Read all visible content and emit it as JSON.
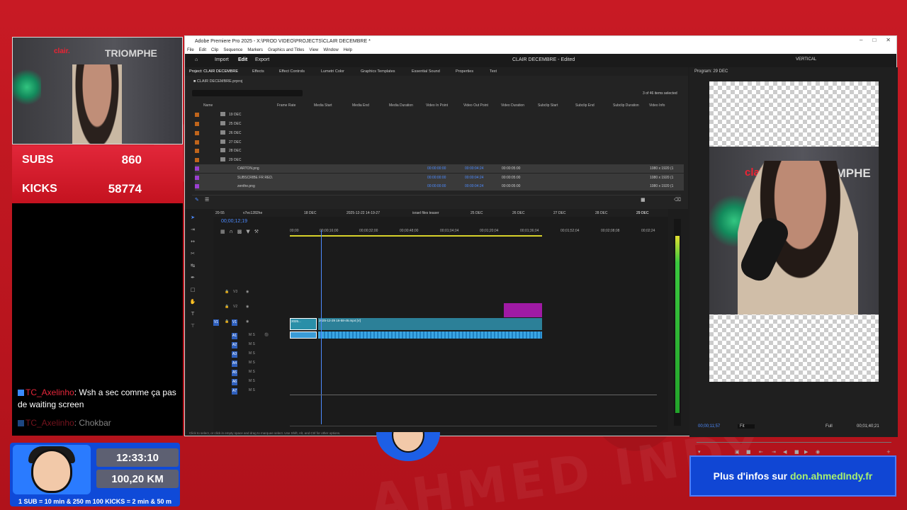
{
  "overlay": {
    "subs_label": "SUBS",
    "subs_value": "860",
    "kicks_label": "KICKS",
    "kicks_value": "58774",
    "cam_sign": "TRIOMPHE",
    "cam_clair": "clair.",
    "chat": [
      {
        "user": "TC_Axelinho",
        "message": "Wsh a sec comme ça pas de waiting screen"
      },
      {
        "user": "TC_Axelinho",
        "message": "Chokbar"
      }
    ],
    "widget": {
      "time": "12:33:10",
      "distance": "100,20 KM",
      "footer": "1 SUB = 10 min & 250 m     100 KICKS = 2 min & 50 m"
    },
    "info_text": "Plus d'infos sur",
    "info_link": "don.ahmedIndy.fr",
    "bg_text": "AHMED INDY"
  },
  "premiere": {
    "title": "Adobe Premiere Pro 2025 - X:\\PROD VIDEO\\PROJECTS\\CLAIR DECEMBRE *",
    "menu": [
      "File",
      "Edit",
      "Clip",
      "Sequence",
      "Markers",
      "Graphics and Titles",
      "View",
      "Window",
      "Help"
    ],
    "appbar": {
      "import": "Import",
      "edit": "Edit",
      "export": "Export",
      "center": "CLAIR DECEMBRE - Edited",
      "vertical": "VERTICAL"
    },
    "tabs": [
      "Project: CLAIR DECEMBRE",
      "Effects",
      "Effect Controls",
      "Lumetri Color",
      "Graphics Templates",
      "Essential Sound",
      "Properties",
      "Text"
    ],
    "project_file": "CLAIR DECEMBRE.prproj",
    "items_selected": "3 of 46 items selected",
    "columns": [
      "Name",
      "Frame Rate",
      "Media Start",
      "Media End",
      "Media Duration",
      "Video In Point",
      "Video Out Point",
      "Video Duration",
      "Subclip Start",
      "Subclip End",
      "Subclip Duration",
      "Video Info"
    ],
    "folders": [
      "19 DEC",
      "25 DEC",
      "26 DEC",
      "27 DEC",
      "28 DEC",
      "29 DEC"
    ],
    "files": [
      {
        "name": "CARTON.png",
        "in": "00:00:00:00",
        "out": "00:00:04:24",
        "dur": "00:00:05:00",
        "info": "1080 x 1920 (1"
      },
      {
        "name": "SUBSCRIBE FR RED.",
        "in": "00:00:00:00",
        "out": "00:00:04:24",
        "dur": "00:00:05:00",
        "info": "1080 x 1920 (1"
      },
      {
        "name": "zenthe.png",
        "in": "00:00:00:00",
        "out": "00:00:04:24",
        "dur": "00:00:05:00",
        "info": "1080 x 1920 (1"
      }
    ],
    "seq_tabs": [
      "20-55",
      "v7ec1282he",
      "18 DEC",
      "2025-12-22 14-19-27",
      "israel files teaser",
      "25 DEC",
      "26 DEC",
      "27 DEC",
      "28 DEC",
      "29 DEC"
    ],
    "timecode": "00;00;12;19",
    "ruler": [
      "00;00",
      "00;00;16;00",
      "00;00;32;00",
      "00;00;48;00",
      "00;01;04;04",
      "00;01;20;04",
      "00;01;36;04",
      "00;01;52;04",
      "00;02;08;08",
      "00;02;24"
    ],
    "tracks_video": [
      "V3",
      "V2",
      "V1"
    ],
    "tracks_audio": [
      "A1",
      "A2",
      "A3",
      "A4",
      "A5",
      "A6",
      "A7"
    ],
    "clip_small": "2025...",
    "clip_main": "2025-12-29 16-58-46.mp4 [V]",
    "program_tab": "Program: 29 DEC",
    "program_tc": "00;00;11;57",
    "program_fit": "Fit",
    "program_full": "Full",
    "program_dur": "00;01;40;21",
    "status": "Click to select, or click in empty space and drag to marquee select. Use Shift, Alt, and Ctrl for other options."
  }
}
